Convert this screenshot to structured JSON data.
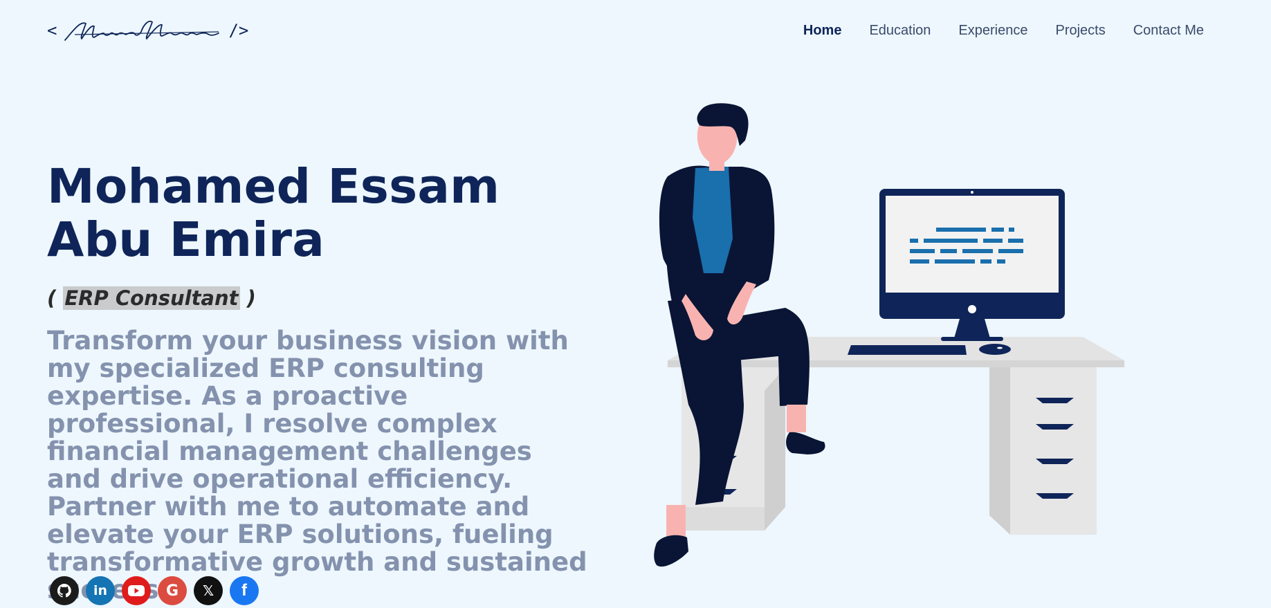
{
  "logo": {
    "open": "<",
    "close": "/>",
    "signature": "Mohamed Abuemira"
  },
  "nav": [
    {
      "label": "Home",
      "active": true
    },
    {
      "label": "Education"
    },
    {
      "label": "Experience"
    },
    {
      "label": "Projects"
    },
    {
      "label": "Contact Me"
    }
  ],
  "hero": {
    "name": "Mohamed Essam Abu Emira",
    "role_open": "(",
    "role": "ERP Consultant",
    "role_close": ")",
    "description": "Transform your business vision with my specialized ERP consulting expertise. As a proactive professional, I resolve complex financial management challenges and drive operational efficiency. Partner with me to automate and elevate your ERP solutions, fueling transformative growth and sustained success."
  },
  "socials": [
    {
      "icon": "github-icon",
      "color": "#1b1b1b"
    },
    {
      "icon": "linkedin-icon",
      "color": "#1574b3",
      "glyph": "in"
    },
    {
      "icon": "youtube-icon",
      "color": "#e01b1b"
    },
    {
      "icon": "google-icon",
      "color": "#dc4b3f",
      "glyph": "G"
    },
    {
      "icon": "x-icon",
      "color": "#111111",
      "glyph": "𝕏"
    },
    {
      "icon": "facebook-icon",
      "color": "#1a77f2",
      "glyph": "f"
    }
  ],
  "colors": {
    "background": "#edf7fd",
    "primary": "#0f2559",
    "muted": "#8492ae",
    "accent_blue": "#1a6fad"
  }
}
